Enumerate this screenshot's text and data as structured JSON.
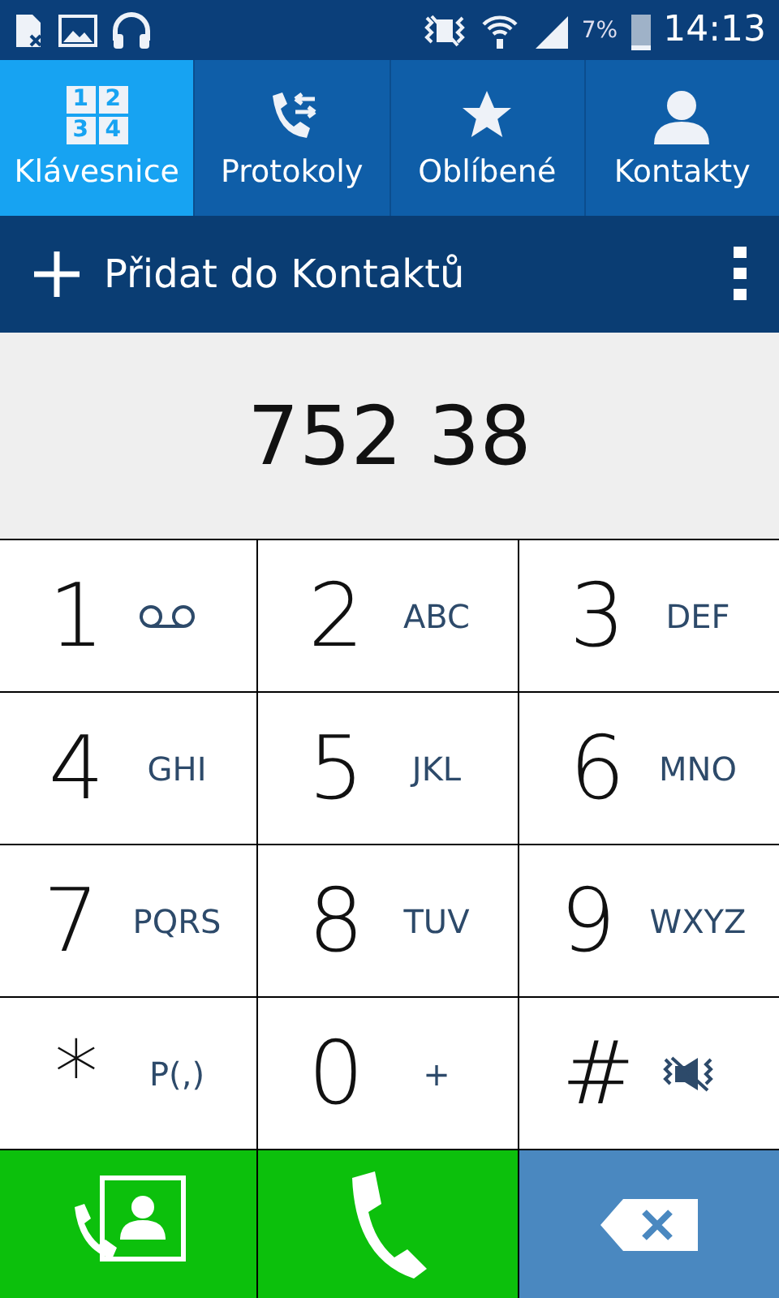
{
  "status_bar": {
    "battery_text": "7%",
    "time": "14:13"
  },
  "tabs": [
    {
      "label": "Klávesnice",
      "selected": true,
      "kind": "keypad",
      "icon_digits": [
        "1",
        "2",
        "3",
        "4"
      ]
    },
    {
      "label": "Protokoly",
      "selected": false,
      "kind": "log"
    },
    {
      "label": "Oblíbené",
      "selected": false,
      "kind": "star"
    },
    {
      "label": "Kontakty",
      "selected": false,
      "kind": "contact"
    }
  ],
  "action_bar": {
    "add_label": "Přidat do Kontaktů"
  },
  "number": "752 38",
  "keys": [
    {
      "digit": "1",
      "kind": "voicemail"
    },
    {
      "digit": "2",
      "kind": "text",
      "sub": "ABC"
    },
    {
      "digit": "3",
      "kind": "text",
      "sub": "DEF"
    },
    {
      "digit": "4",
      "kind": "text",
      "sub": "GHI"
    },
    {
      "digit": "5",
      "kind": "text",
      "sub": "JKL"
    },
    {
      "digit": "6",
      "kind": "text",
      "sub": "MNO"
    },
    {
      "digit": "7",
      "kind": "text",
      "sub": "PQRS"
    },
    {
      "digit": "8",
      "kind": "text",
      "sub": "TUV"
    },
    {
      "digit": "9",
      "kind": "text",
      "sub": "WXYZ"
    },
    {
      "digit": "*",
      "kind": "text",
      "sub": "P(,)"
    },
    {
      "digit": "0",
      "kind": "text",
      "sub": "+"
    },
    {
      "digit": "#",
      "kind": "mute"
    }
  ]
}
